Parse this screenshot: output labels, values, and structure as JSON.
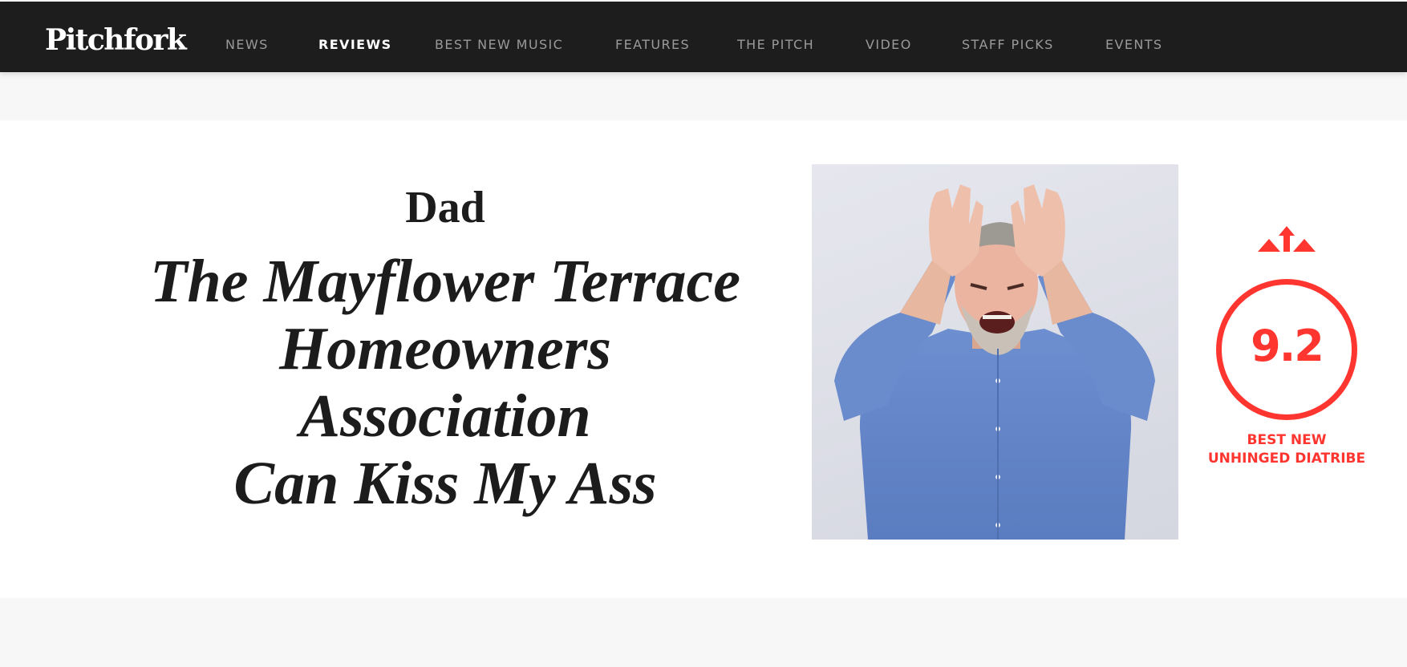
{
  "header": {
    "logo": "Pitchfork",
    "nav": [
      {
        "label": "NEWS",
        "active": false
      },
      {
        "label": "REVIEWS",
        "active": true
      },
      {
        "label": "BEST NEW MUSIC",
        "active": false
      },
      {
        "label": "FEATURES",
        "active": false
      },
      {
        "label": "THE PITCH",
        "active": false
      },
      {
        "label": "VIDEO",
        "active": false
      },
      {
        "label": "STAFF PICKS",
        "active": false
      },
      {
        "label": "EVENTS",
        "active": false
      }
    ]
  },
  "review": {
    "artist": "Dad",
    "album_lines": [
      "The Mayflower Terrace",
      "Homeowners",
      "Association",
      "Can Kiss My Ass"
    ],
    "score": "9.2",
    "badge_lines": [
      "BEST NEW",
      "UNHINGED DIATRIBE"
    ],
    "badge_icon": "up-arrow-icon"
  },
  "colors": {
    "nav_background": "#1d1d1d",
    "accent": "#ff3530",
    "page_background": "#f7f7f7",
    "content_background": "#ffffff"
  }
}
